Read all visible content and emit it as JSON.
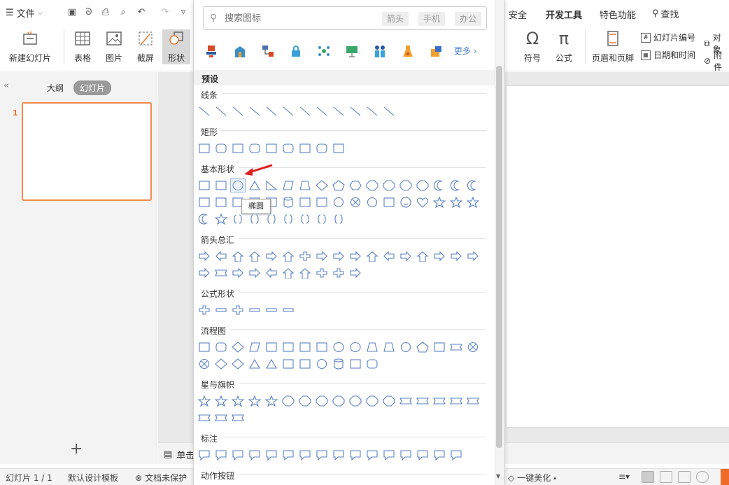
{
  "menubar": {
    "file_label": "文件",
    "tabs_right": [
      "安全",
      "开发工具",
      "特色功能"
    ],
    "find_label": "查找"
  },
  "ribbon": {
    "new_slide": "新建幻灯片",
    "table": "表格",
    "picture": "图片",
    "screenshot": "截屏",
    "shape": "形状",
    "symbol": "符号",
    "formula": "公式",
    "header_footer": "页眉和页脚",
    "slide_number": "幻灯片编号",
    "date_time": "日期和时间",
    "object": "对象",
    "attachment": "附件"
  },
  "left_panel": {
    "tab_outline": "大纲",
    "tab_slides": "幻灯片",
    "slide_number": "1"
  },
  "canvas": {
    "notes_label": "单击此处添加备注"
  },
  "status": {
    "slide_info": "幻灯片 1 / 1",
    "template": "默认设计模板",
    "protect": "文档未保护",
    "beautify": "一键美化"
  },
  "shape_panel": {
    "search_placeholder": "搜索图标",
    "tags": [
      "箭头",
      "手机",
      "办公"
    ],
    "more_label": "更多",
    "preset_label": "预设",
    "categories": [
      "线条",
      "矩形",
      "基本形状",
      "箭头总汇",
      "公式形状",
      "流程图",
      "星与旗帜",
      "标注",
      "动作按钮"
    ],
    "tooltip": "椭圆",
    "line_color": "#5b80c2"
  },
  "colors": {
    "accent_orange": "#f06a2a",
    "link_blue": "#4a7fd0"
  }
}
